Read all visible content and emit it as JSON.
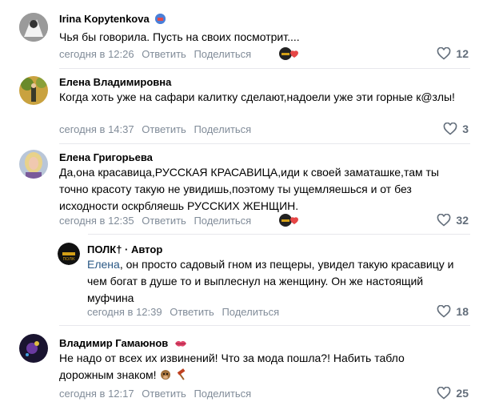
{
  "comments": [
    {
      "author": "Irina Kopytenkova",
      "badge_icon": "avatar-badge-icon",
      "text": "Чья бы говорила. Пусть на своих посмотрит....",
      "time": "сегодня в 12:26",
      "reply_label": "Ответить",
      "share_label": "Поделиться",
      "likes": "12"
    },
    {
      "author": "Елена Владимировна",
      "text": "Когда хоть уже на сафари калитку сделают,надоели уже эти горные к@злы!",
      "time": "сегодня в 14:37",
      "reply_label": "Ответить",
      "share_label": "Поделиться",
      "likes": "3"
    },
    {
      "author": "Елена Григорьева",
      "text": "Да,она красавица,РУССКАЯ КРАСАВИЦА,иди к своей заматашке,там ты точно красоту такую не увидишь,поэтому ты ущемляешься и от без исходности оскрбляешь РУССКИХ ЖЕНЩИН.",
      "time": "сегодня в 12:35",
      "reply_label": "Ответить",
      "share_label": "Поделиться",
      "likes": "32"
    },
    {
      "author": "ПОЛК†",
      "role": " · Автор",
      "mention": "Елена",
      "text": ", он просто садовый гном из пещеры, увидел такую красавицу и чем богат в душе то и выплеснул на женщину. Он же настоящий муфчина",
      "time": "сегодня в 12:39",
      "reply_label": "Ответить",
      "share_label": "Поделиться",
      "likes": "18"
    },
    {
      "author": "Владимир Гамаюнов",
      "text": "Не надо от всех их извинений! Что за мода пошла?! Набить табло дорожным знаком!",
      "time": "сегодня в 12:17",
      "reply_label": "Ответить",
      "share_label": "Поделиться",
      "likes": "25"
    }
  ],
  "colors": {
    "meta": "#818c99",
    "like": "#626d7a",
    "mention": "#2a5885",
    "divider": "#e7e8ec"
  }
}
